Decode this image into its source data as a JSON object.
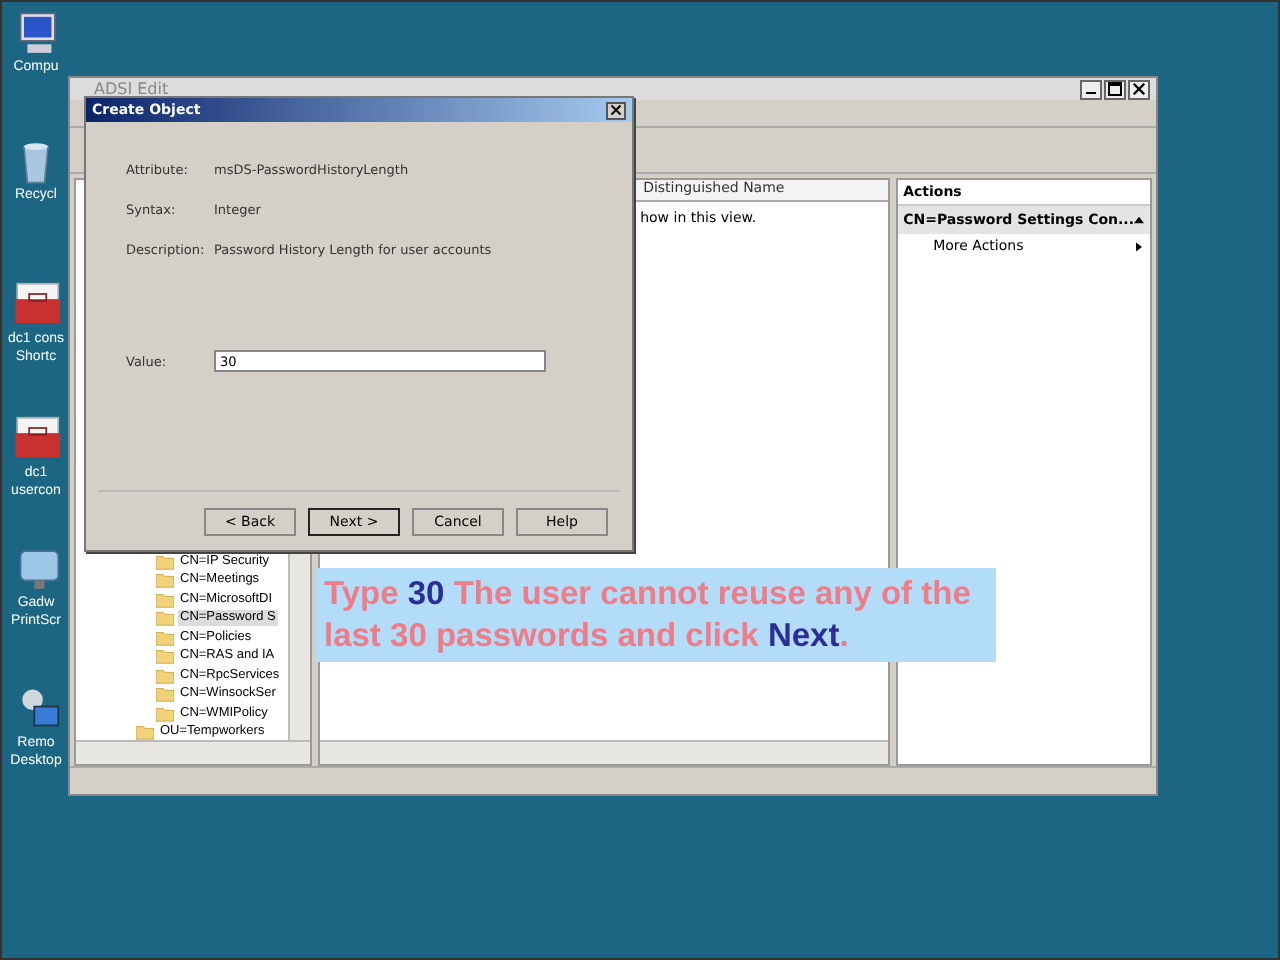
{
  "desktop_icons": [
    {
      "kind": "computer",
      "lines": [
        "Compu"
      ]
    },
    {
      "kind": "recycle",
      "lines": [
        "Recycl"
      ]
    },
    {
      "kind": "toolbox",
      "lines": [
        "dc1 cons",
        "Shortc"
      ]
    },
    {
      "kind": "toolbox",
      "lines": [
        "dc1",
        "usercon"
      ]
    },
    {
      "kind": "monitor",
      "lines": [
        "Gadw",
        "PrintScr"
      ]
    },
    {
      "kind": "remote",
      "lines": [
        "Remo",
        "Desktop"
      ]
    }
  ],
  "main_window": {
    "title": "ADSI Edit",
    "tree": {
      "nested_items": [
        {
          "label": "CN=IP Security",
          "selected": false
        },
        {
          "label": "CN=Meetings",
          "selected": false
        },
        {
          "label": "CN=MicrosoftDI",
          "selected": false
        },
        {
          "label": "CN=Password S",
          "selected": true
        },
        {
          "label": "CN=Policies",
          "selected": false
        },
        {
          "label": "CN=RAS and IA",
          "selected": false
        },
        {
          "label": "CN=RpcServices",
          "selected": false
        },
        {
          "label": "CN=WinsockSer",
          "selected": false
        },
        {
          "label": "CN=WMIPolicy",
          "selected": false
        }
      ],
      "items": [
        {
          "label": "OU=Tempworkers",
          "selected": false
        }
      ]
    },
    "list": {
      "column": "Distinguished Name",
      "empty_text": "how in this view."
    },
    "actions": {
      "title": "Actions",
      "section": "CN=Password Settings Con...",
      "items": [
        "More Actions"
      ]
    }
  },
  "dialog": {
    "title": "Create Object",
    "fields": [
      {
        "label": "Attribute:",
        "value": "msDS-PasswordHistoryLength"
      },
      {
        "label": "Syntax:",
        "value": "Integer"
      },
      {
        "label": "Description:",
        "value": "Password History Length for user accounts"
      }
    ],
    "input": {
      "label": "Value:",
      "value": "30"
    },
    "buttons": [
      {
        "label": "< Back",
        "default": false
      },
      {
        "label": "Next >",
        "default": true
      },
      {
        "label": "Cancel",
        "default": false
      },
      {
        "label": "Help",
        "default": false
      }
    ]
  },
  "callout": {
    "segments": [
      {
        "text": "Type ",
        "kind": "plain"
      },
      {
        "text": "30",
        "kind": "emphasis"
      },
      {
        "text": " The user cannot reuse any of the last 30 passwords and click ",
        "kind": "plain"
      },
      {
        "text": "Next",
        "kind": "emphasis"
      },
      {
        "text": ".",
        "kind": "plain"
      }
    ]
  }
}
